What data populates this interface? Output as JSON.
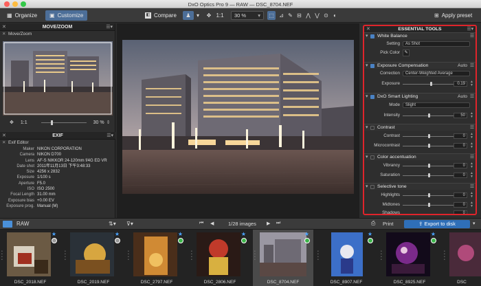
{
  "app": {
    "title": "DxO Optics Pro 9 — RAW — DSC_8704.NEF"
  },
  "toolbar": {
    "organize": "Organize",
    "customize": "Customize",
    "compare": "Compare",
    "ratio": "1:1",
    "zoom": "30 %",
    "apply_preset": "Apply preset"
  },
  "left_panel": {
    "move_zoom": {
      "title": "MOVE/ZOOM",
      "sub": "Move/Zoom",
      "ratio": "1:1",
      "zoom": "30 %"
    },
    "exif": {
      "title": "EXIF",
      "sub": "Exif Editor",
      "rows": [
        {
          "k": "Maker",
          "v": "NIKON CORPORATION"
        },
        {
          "k": "Camera",
          "v": "NIKON D700"
        },
        {
          "k": "Lens",
          "v": "AF-S NIKKOR 24-120mm f/4G ED VR"
        },
        {
          "k": "Date shot",
          "v": "2011年11月13日 下午3:48:33"
        },
        {
          "k": "Size",
          "v": "4256 x 2832"
        },
        {
          "k": "Exposure",
          "v": "1/100 s"
        },
        {
          "k": "Aperture",
          "v": "F5.0"
        },
        {
          "k": "ISO",
          "v": "ISO 2500"
        },
        {
          "k": "Focal Length",
          "v": "31.00 mm"
        },
        {
          "k": "Exposure bias",
          "v": "+0.00 EV"
        },
        {
          "k": "Exposure prog.",
          "v": "Manual (M)"
        }
      ]
    }
  },
  "right_panel": {
    "title": "ESSENTIAL TOOLS",
    "white_balance": {
      "label": "White Balance",
      "setting_k": "Setting",
      "setting_v": "As Shot",
      "pick_k": "Pick Color"
    },
    "exposure": {
      "label": "Exposure Compensation",
      "auto": "Auto",
      "correction_k": "Correction",
      "correction_v": "Center-Weighted Average",
      "exposure_k": "Exposure",
      "exposure_v": "0.19"
    },
    "smart_lighting": {
      "label": "DxO Smart Lighting",
      "auto": "Auto",
      "mode_k": "Mode",
      "mode_v": "Slight",
      "intensity_k": "Intensity",
      "intensity_v": "50"
    },
    "contrast": {
      "label": "Contrast",
      "contrast_k": "Contrast",
      "contrast_v": "0",
      "micro_k": "Microcontrast",
      "micro_v": "0"
    },
    "color": {
      "label": "Color accentuation",
      "vibrancy_k": "Vibrancy",
      "vibrancy_v": "0",
      "saturation_k": "Saturation",
      "saturation_v": "0"
    },
    "selective": {
      "label": "Selective tone",
      "highlights_k": "Highlights",
      "highlights_v": "0",
      "midtones_k": "Midtones",
      "midtones_v": "0",
      "shadows_k": "Shadows",
      "shadows_v": "0"
    }
  },
  "filmstrip": {
    "folder": "RAW",
    "counter": "1/28 images",
    "print": "Print",
    "export": "Export to disk",
    "items": [
      {
        "name": "DSC_2018.NEF"
      },
      {
        "name": "DSC_2019.NEF"
      },
      {
        "name": "DSC_2797.NEF"
      },
      {
        "name": "DSC_2806.NEF"
      },
      {
        "name": "DSC_8704.NEF"
      },
      {
        "name": "DSC_8907.NEF"
      },
      {
        "name": "DSC_8925.NEF"
      },
      {
        "name": "DSC"
      }
    ]
  },
  "colors": {
    "accent": "#4a82c4",
    "highlight": "#e0242b",
    "export": "#2f6fb8"
  }
}
